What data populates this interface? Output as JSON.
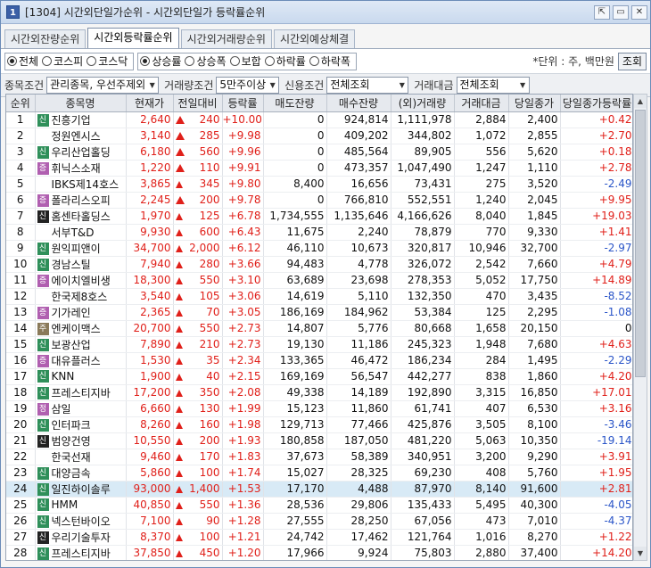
{
  "window": {
    "title": "[1304] 시간외단일가순위 - 시간외단일가 등락률순위",
    "icon_label": "1",
    "buttons": [
      "⇱",
      "▭",
      "✕"
    ]
  },
  "tabs": [
    {
      "label": "시간외잔량순위",
      "active": false
    },
    {
      "label": "시간외등락률순위",
      "active": true
    },
    {
      "label": "시간외거래량순위",
      "active": false
    },
    {
      "label": "시간외예상체결",
      "active": false
    }
  ],
  "market_radios": [
    {
      "label": "전체",
      "on": true
    },
    {
      "label": "코스피",
      "on": false
    },
    {
      "label": "코스닥",
      "on": false
    }
  ],
  "sort_radios": [
    {
      "label": "상승률",
      "on": true
    },
    {
      "label": "상승폭",
      "on": false
    },
    {
      "label": "보합",
      "on": false
    },
    {
      "label": "하락률",
      "on": false
    },
    {
      "label": "하락폭",
      "on": false
    }
  ],
  "unit_text": "*단위 : 주, 백만원",
  "query_button": "조회",
  "filters": {
    "item_cond_label": "종목조건",
    "item_cond_value": "관리종목, 우선주제외",
    "volume_cond_label": "거래량조건",
    "volume_cond_value": "5만주이상",
    "credit_cond_label": "신용조건",
    "credit_cond_value": "전체조회",
    "amount_label": "거래대금",
    "amount_value": "전체조회"
  },
  "columns": [
    "순위",
    "종목명",
    "현재가",
    "전일대비",
    "등락률",
    "매도잔량",
    "매수잔량",
    "(외)거래량",
    "거래대금",
    "당일종가",
    "당일종가등락률"
  ],
  "rows": [
    {
      "rank": "1",
      "badge": "신",
      "badge_color": "#2f8f5a",
      "name": "진흥기업",
      "price": "2,640",
      "arrow": "up",
      "diff": "240",
      "rate": "+10.00",
      "sell": "0",
      "buy": "924,814",
      "volume": "1,111,978",
      "amount": "2,884",
      "close": "2,400",
      "close_rate": "+0.42",
      "close_color": "red"
    },
    {
      "rank": "2",
      "badge": "",
      "badge_color": "",
      "name": "정원엔시스",
      "price": "3,140",
      "arrow": "up",
      "diff": "285",
      "rate": "+9.98",
      "sell": "0",
      "buy": "409,202",
      "volume": "344,802",
      "amount": "1,072",
      "close": "2,855",
      "close_rate": "+2.70",
      "close_color": "red"
    },
    {
      "rank": "3",
      "badge": "신",
      "badge_color": "#2f8f5a",
      "name": "우리산업홀딩",
      "price": "6,180",
      "arrow": "up",
      "diff": "560",
      "rate": "+9.96",
      "sell": "0",
      "buy": "485,564",
      "volume": "89,905",
      "amount": "556",
      "close": "5,620",
      "close_rate": "+0.18",
      "close_color": "red"
    },
    {
      "rank": "4",
      "badge": "증",
      "badge_color": "#b05fb0",
      "name": "휘닉스소재",
      "price": "1,220",
      "arrow": "up",
      "diff": "110",
      "rate": "+9.91",
      "sell": "0",
      "buy": "473,357",
      "volume": "1,047,490",
      "amount": "1,247",
      "close": "1,110",
      "close_rate": "+2.78",
      "close_color": "red"
    },
    {
      "rank": "5",
      "badge": "",
      "badge_color": "",
      "name": "IBKS제14호스",
      "price": "3,865",
      "arrow": "tri",
      "diff": "345",
      "rate": "+9.80",
      "sell": "8,400",
      "buy": "16,656",
      "volume": "73,431",
      "amount": "275",
      "close": "3,520",
      "close_rate": "-2.49",
      "close_color": "blue"
    },
    {
      "rank": "6",
      "badge": "증",
      "badge_color": "#b05fb0",
      "name": "폴라리스오피",
      "price": "2,245",
      "arrow": "up",
      "diff": "200",
      "rate": "+9.78",
      "sell": "0",
      "buy": "766,810",
      "volume": "552,551",
      "amount": "1,240",
      "close": "2,045",
      "close_rate": "+9.95",
      "close_color": "red"
    },
    {
      "rank": "7",
      "badge": "신",
      "badge_color": "#222222",
      "name": "홈센타홀딩스",
      "price": "1,970",
      "arrow": "tri",
      "diff": "125",
      "rate": "+6.78",
      "sell": "1,734,555",
      "buy": "1,135,646",
      "volume": "4,166,626",
      "amount": "8,040",
      "close": "1,845",
      "close_rate": "+19.03",
      "close_color": "red"
    },
    {
      "rank": "8",
      "badge": "",
      "badge_color": "",
      "name": "서부T&D",
      "price": "9,930",
      "arrow": "tri",
      "diff": "600",
      "rate": "+6.43",
      "sell": "11,675",
      "buy": "2,240",
      "volume": "78,879",
      "amount": "770",
      "close": "9,330",
      "close_rate": "+1.41",
      "close_color": "red"
    },
    {
      "rank": "9",
      "badge": "신",
      "badge_color": "#2f8f5a",
      "name": "원익피앤이",
      "price": "34,700",
      "arrow": "tri",
      "diff": "2,000",
      "rate": "+6.12",
      "sell": "46,110",
      "buy": "10,673",
      "volume": "320,817",
      "amount": "10,946",
      "close": "32,700",
      "close_rate": "-2.97",
      "close_color": "blue"
    },
    {
      "rank": "10",
      "badge": "신",
      "badge_color": "#2f8f5a",
      "name": "경남스틸",
      "price": "7,940",
      "arrow": "tri",
      "diff": "280",
      "rate": "+3.66",
      "sell": "94,483",
      "buy": "4,778",
      "volume": "326,072",
      "amount": "2,542",
      "close": "7,660",
      "close_rate": "+4.79",
      "close_color": "red"
    },
    {
      "rank": "11",
      "badge": "증",
      "badge_color": "#b05fb0",
      "name": "에이치엘비생",
      "price": "18,300",
      "arrow": "tri",
      "diff": "550",
      "rate": "+3.10",
      "sell": "63,689",
      "buy": "23,698",
      "volume": "278,353",
      "amount": "5,052",
      "close": "17,750",
      "close_rate": "+14.89",
      "close_color": "red"
    },
    {
      "rank": "12",
      "badge": "",
      "badge_color": "",
      "name": "한국제8호스",
      "price": "3,540",
      "arrow": "tri",
      "diff": "105",
      "rate": "+3.06",
      "sell": "14,619",
      "buy": "5,110",
      "volume": "132,350",
      "amount": "470",
      "close": "3,435",
      "close_rate": "-8.52",
      "close_color": "blue"
    },
    {
      "rank": "13",
      "badge": "증",
      "badge_color": "#b05fb0",
      "name": "기가레인",
      "price": "2,365",
      "arrow": "tri",
      "diff": "70",
      "rate": "+3.05",
      "sell": "186,169",
      "buy": "184,962",
      "volume": "53,384",
      "amount": "125",
      "close": "2,295",
      "close_rate": "-1.08",
      "close_color": "blue"
    },
    {
      "rank": "14",
      "badge": "주",
      "badge_color": "#8a7a5a",
      "name": "엔케이맥스",
      "price": "20,700",
      "arrow": "tri",
      "diff": "550",
      "rate": "+2.73",
      "sell": "14,807",
      "buy": "5,776",
      "volume": "80,668",
      "amount": "1,658",
      "close": "20,150",
      "close_rate": "0",
      "close_color": "black"
    },
    {
      "rank": "15",
      "badge": "신",
      "badge_color": "#2f8f5a",
      "name": "보광산업",
      "price": "7,890",
      "arrow": "tri",
      "diff": "210",
      "rate": "+2.73",
      "sell": "19,130",
      "buy": "11,186",
      "volume": "245,323",
      "amount": "1,948",
      "close": "7,680",
      "close_rate": "+4.63",
      "close_color": "red"
    },
    {
      "rank": "16",
      "badge": "증",
      "badge_color": "#b05fb0",
      "name": "대유플러스",
      "price": "1,530",
      "arrow": "tri",
      "diff": "35",
      "rate": "+2.34",
      "sell": "133,365",
      "buy": "46,472",
      "volume": "186,234",
      "amount": "284",
      "close": "1,495",
      "close_rate": "-2.29",
      "close_color": "blue"
    },
    {
      "rank": "17",
      "badge": "신",
      "badge_color": "#2f8f5a",
      "name": "KNN",
      "price": "1,900",
      "arrow": "tri",
      "diff": "40",
      "rate": "+2.15",
      "sell": "169,169",
      "buy": "56,547",
      "volume": "442,277",
      "amount": "838",
      "close": "1,860",
      "close_rate": "+4.20",
      "close_color": "red"
    },
    {
      "rank": "18",
      "badge": "신",
      "badge_color": "#2f8f5a",
      "name": "프레스티지바",
      "price": "17,200",
      "arrow": "tri",
      "diff": "350",
      "rate": "+2.08",
      "sell": "49,338",
      "buy": "14,189",
      "volume": "192,890",
      "amount": "3,315",
      "close": "16,850",
      "close_rate": "+17.01",
      "close_color": "red"
    },
    {
      "rank": "19",
      "badge": "정",
      "badge_color": "#b05fb0",
      "name": "삼일",
      "price": "6,660",
      "arrow": "tri",
      "diff": "130",
      "rate": "+1.99",
      "sell": "15,123",
      "buy": "11,860",
      "volume": "61,741",
      "amount": "407",
      "close": "6,530",
      "close_rate": "+3.16",
      "close_color": "red"
    },
    {
      "rank": "20",
      "badge": "신",
      "badge_color": "#2f8f5a",
      "name": "인터파크",
      "price": "8,260",
      "arrow": "tri",
      "diff": "160",
      "rate": "+1.98",
      "sell": "129,713",
      "buy": "77,466",
      "volume": "425,876",
      "amount": "3,505",
      "close": "8,100",
      "close_rate": "-3.46",
      "close_color": "blue"
    },
    {
      "rank": "21",
      "badge": "신",
      "badge_color": "#222222",
      "name": "범양건영",
      "price": "10,550",
      "arrow": "tri",
      "diff": "200",
      "rate": "+1.93",
      "sell": "180,858",
      "buy": "187,050",
      "volume": "481,220",
      "amount": "5,063",
      "close": "10,350",
      "close_rate": "-19.14",
      "close_color": "blue"
    },
    {
      "rank": "22",
      "badge": "",
      "badge_color": "",
      "name": "한국선재",
      "price": "9,460",
      "arrow": "tri",
      "diff": "170",
      "rate": "+1.83",
      "sell": "37,673",
      "buy": "58,389",
      "volume": "340,951",
      "amount": "3,200",
      "close": "9,290",
      "close_rate": "+3.91",
      "close_color": "red"
    },
    {
      "rank": "23",
      "badge": "신",
      "badge_color": "#2f8f5a",
      "name": "대양금속",
      "price": "5,860",
      "arrow": "tri",
      "diff": "100",
      "rate": "+1.74",
      "sell": "15,027",
      "buy": "28,325",
      "volume": "69,230",
      "amount": "408",
      "close": "5,760",
      "close_rate": "+1.95",
      "close_color": "red"
    },
    {
      "rank": "24",
      "badge": "신",
      "badge_color": "#2f8f5a",
      "name": "일진하이솔루",
      "price": "93,000",
      "arrow": "tri",
      "diff": "1,400",
      "rate": "+1.53",
      "sell": "17,170",
      "buy": "4,488",
      "volume": "87,970",
      "amount": "8,140",
      "close": "91,600",
      "close_rate": "+2.81",
      "close_color": "red",
      "highlight": true
    },
    {
      "rank": "25",
      "badge": "신",
      "badge_color": "#2f8f5a",
      "name": "HMM",
      "price": "40,850",
      "arrow": "tri",
      "diff": "550",
      "rate": "+1.36",
      "sell": "28,536",
      "buy": "29,806",
      "volume": "135,433",
      "amount": "5,495",
      "close": "40,300",
      "close_rate": "-4.05",
      "close_color": "blue"
    },
    {
      "rank": "26",
      "badge": "신",
      "badge_color": "#2f8f5a",
      "name": "넥스턴바이오",
      "price": "7,100",
      "arrow": "tri",
      "diff": "90",
      "rate": "+1.28",
      "sell": "27,555",
      "buy": "28,250",
      "volume": "67,056",
      "amount": "473",
      "close": "7,010",
      "close_rate": "-4.37",
      "close_color": "blue"
    },
    {
      "rank": "27",
      "badge": "신",
      "badge_color": "#222222",
      "name": "우리기술투자",
      "price": "8,370",
      "arrow": "tri",
      "diff": "100",
      "rate": "+1.21",
      "sell": "24,742",
      "buy": "17,462",
      "volume": "121,764",
      "amount": "1,016",
      "close": "8,270",
      "close_rate": "+1.22",
      "close_color": "red"
    },
    {
      "rank": "28",
      "badge": "신",
      "badge_color": "#2f8f5a",
      "name": "프레스티지바",
      "price": "37,850",
      "arrow": "tri",
      "diff": "450",
      "rate": "+1.20",
      "sell": "17,966",
      "buy": "9,924",
      "volume": "75,803",
      "amount": "2,880",
      "close": "37,400",
      "close_rate": "+14.20",
      "close_color": "red"
    }
  ]
}
